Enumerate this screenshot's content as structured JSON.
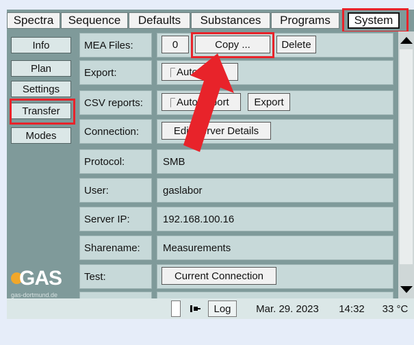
{
  "tabs": [
    "Spectra",
    "Sequence",
    "Defaults",
    "Substances",
    "Programs",
    "System"
  ],
  "active_tab": "System",
  "sidebar": [
    "Info",
    "Plan",
    "Settings",
    "Transfer",
    "Modes"
  ],
  "active_sidebar": "Transfer",
  "logo": {
    "text": "GAS",
    "sub": "gas-dortmund.de"
  },
  "rows": {
    "mea_files": {
      "label": "MEA Files:",
      "count": "0",
      "copy": "Copy ...",
      "delete": "Delete"
    },
    "export": {
      "label": "Export:",
      "auto": "Automatic"
    },
    "csv": {
      "label": "CSV reports:",
      "auto": "Auto export",
      "export": "Export"
    },
    "connection": {
      "label": "Connection:",
      "edit": "Edit Server Details"
    },
    "protocol": {
      "label": "Protocol:",
      "value": "SMB"
    },
    "user": {
      "label": "User:",
      "value": "gaslabor"
    },
    "server_ip": {
      "label": "Server IP:",
      "value": "192.168.100.16"
    },
    "sharename": {
      "label": "Sharename:",
      "value": "Measurements"
    },
    "test": {
      "label": "Test:",
      "button": "Current Connection"
    }
  },
  "status": {
    "icon": "plug-icon",
    "log": "Log",
    "date": "Mar. 29. 2023",
    "time": "14:32",
    "temp": "33 °C"
  },
  "colors": {
    "panel": "#7f9a9a",
    "cell": "#c7d9d9",
    "annotation": "#e8232a",
    "background": "#e6edf9"
  }
}
